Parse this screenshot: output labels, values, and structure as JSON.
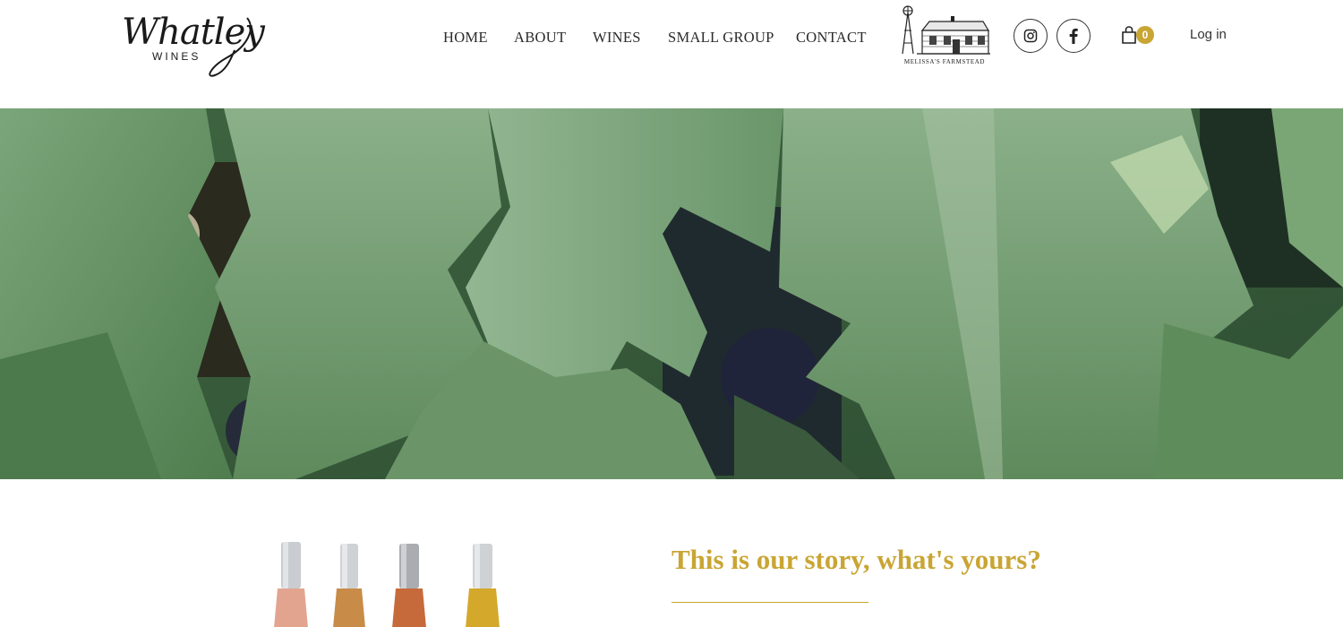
{
  "brand": {
    "logo_script": "Whatley",
    "logo_sub": "WINES",
    "partner_logo_caption": "MELISSA'S FARMSTEAD"
  },
  "nav": {
    "items": [
      {
        "label": "HOME"
      },
      {
        "label": "ABOUT"
      },
      {
        "label": "WINES"
      },
      {
        "label": "SMALL GROUP"
      },
      {
        "label": "CONTACT"
      }
    ]
  },
  "header": {
    "social": [
      {
        "icon": "instagram-icon"
      },
      {
        "icon": "facebook-icon"
      }
    ],
    "cart": {
      "icon": "shopping-bag-icon",
      "count": "0"
    },
    "login_label": "Log in"
  },
  "hero": {
    "image": "grape-vine-leaves"
  },
  "story": {
    "title": "This is our story, what's yours?"
  },
  "colors": {
    "accent_gold": "#c9a534",
    "text_dark": "#2b2b2b",
    "leaf_green": "#5f8a5a"
  }
}
